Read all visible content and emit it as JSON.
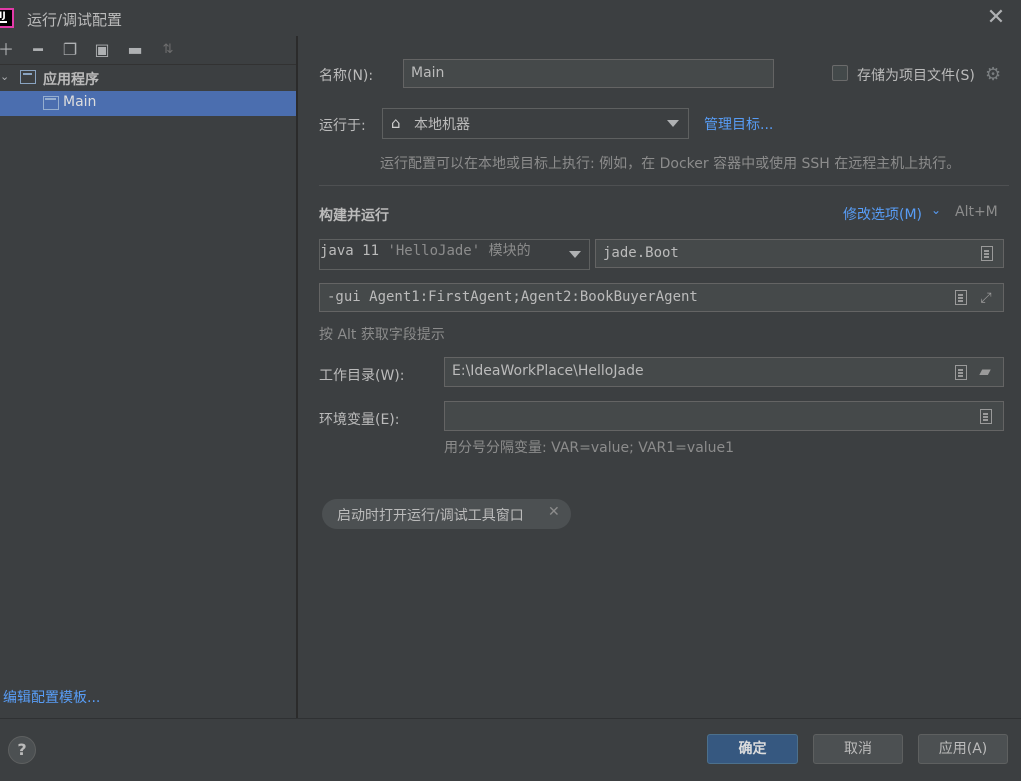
{
  "window": {
    "title": "运行/调试配置",
    "close_icon": "close-icon"
  },
  "toolbar": {
    "icons": [
      "add-icon",
      "remove-icon",
      "copy-icon",
      "save-icon",
      "new-folder-icon",
      "sort-icon"
    ]
  },
  "tree": {
    "group_label": "应用程序",
    "items": [
      {
        "label": "Main",
        "selected": true
      }
    ]
  },
  "left_footer": {
    "edit_templates": "编辑配置模板..."
  },
  "form": {
    "name_label": "名称(N):",
    "name_value": "Main",
    "store_as_file_label": "存储为项目文件(S)",
    "store_as_file_checked": false,
    "run_on_label": "运行于:",
    "run_on_value": "本地机器",
    "manage_targets": "管理目标...",
    "run_on_hint": "运行配置可以在本地或目标上执行: 例如，在 Docker 容器中或使用 SSH 在远程主机上执行。",
    "build_run_title": "构建并运行",
    "modify_options": "修改选项(M)",
    "modify_shortcut": "Alt+M",
    "jre_value": "java 11",
    "jre_module": "'HelloJade'",
    "jre_suffix": "模块的",
    "main_class": "jade.Boot",
    "program_args": "-gui Agent1:FirstAgent;Agent2:BookBuyerAgent",
    "alt_hint": "按 Alt 获取字段提示",
    "workdir_label": "工作目录(W):",
    "workdir_value": "E:\\IdeaWorkPlace\\HelloJade",
    "env_label": "环境变量(E):",
    "env_value": "",
    "env_hint": "用分号分隔变量: VAR=value; VAR1=value1",
    "chip_label": "启动时打开运行/调试工具窗口"
  },
  "footer": {
    "help": "?",
    "ok": "确定",
    "cancel": "取消",
    "apply": "应用(A)"
  },
  "colors": {
    "accent": "#4b6eaf",
    "link": "#589df6",
    "primary_button": "#365880",
    "background": "#3c3f41"
  }
}
